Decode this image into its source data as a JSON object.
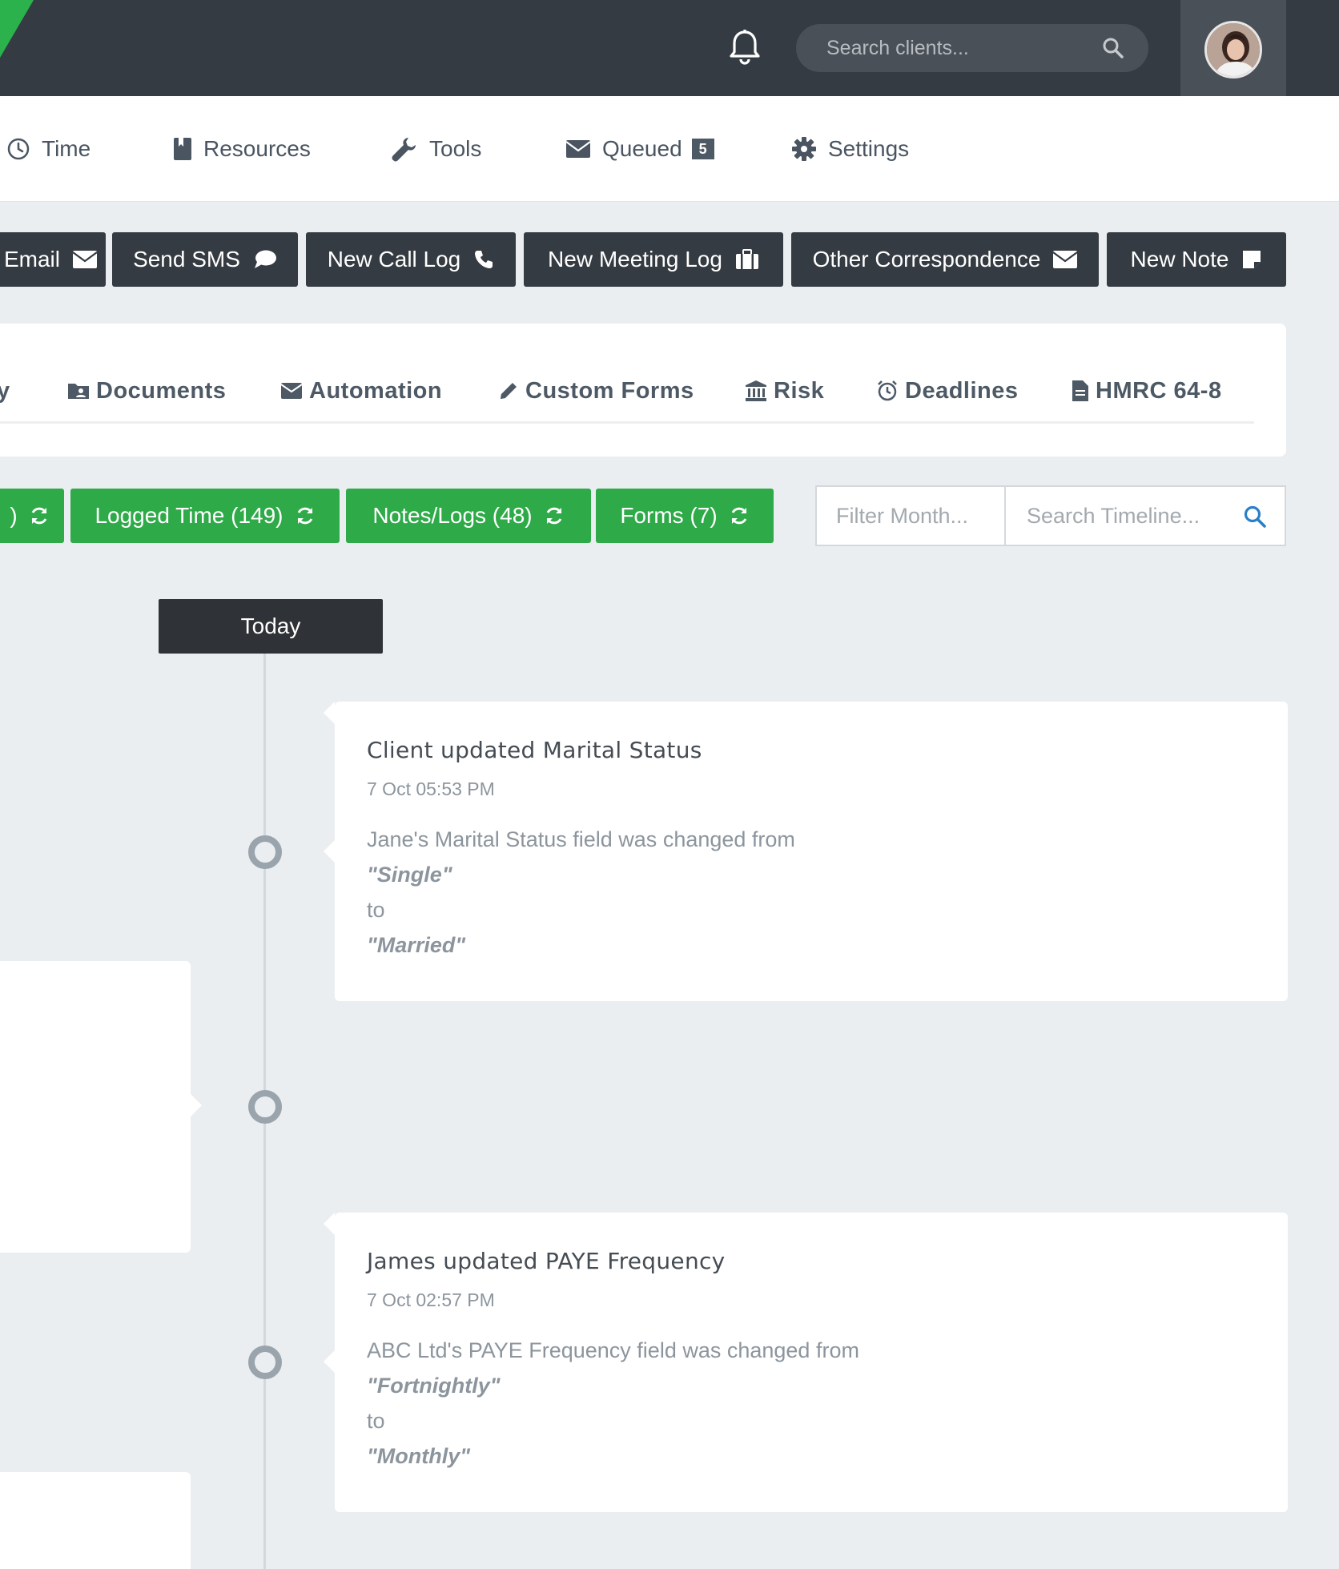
{
  "topbar": {
    "search_placeholder": "Search clients...",
    "notification_icon": "bell-icon",
    "avatar_alt": "user-avatar"
  },
  "nav": {
    "items": [
      {
        "label": "Time",
        "icon": "clock-icon"
      },
      {
        "label": "Resources",
        "icon": "book-icon"
      },
      {
        "label": "Tools",
        "icon": "wrench-icon"
      },
      {
        "label": "Queued",
        "icon": "envelope-icon",
        "badge": "5"
      },
      {
        "label": "Settings",
        "icon": "gear-icon"
      }
    ]
  },
  "actions": [
    {
      "label": "Email",
      "icon": "envelope-icon"
    },
    {
      "label": "Send SMS",
      "icon": "speech-bubble-icon"
    },
    {
      "label": "New Call Log",
      "icon": "phone-icon"
    },
    {
      "label": "New Meeting Log",
      "icon": "briefcase-icon"
    },
    {
      "label": "Other Correspondence",
      "icon": "envelope-icon"
    },
    {
      "label": "New Note",
      "icon": "note-icon"
    }
  ],
  "tabs": [
    {
      "label": "y",
      "icon": ""
    },
    {
      "label": "Documents",
      "icon": "folder-user-icon"
    },
    {
      "label": "Automation",
      "icon": "envelope-icon"
    },
    {
      "label": "Custom Forms",
      "icon": "pencil-icon"
    },
    {
      "label": "Risk",
      "icon": "bank-icon"
    },
    {
      "label": "Deadlines",
      "icon": "alarm-clock-icon"
    },
    {
      "label": "HMRC 64-8",
      "icon": "file-icon"
    }
  ],
  "filters": [
    {
      "label": ")"
    },
    {
      "label": "Logged Time (149)"
    },
    {
      "label": "Notes/Logs (48)"
    },
    {
      "label": "Forms (7)"
    }
  ],
  "timeline_search": {
    "month_placeholder": "Filter Month...",
    "search_placeholder": "Search Timeline..."
  },
  "timeline": {
    "today_label": "Today",
    "events": [
      {
        "title": "Client updated Marital Status",
        "time": "7 Oct 05:53 PM",
        "body_intro": "Jane's Marital Status field was changed from",
        "from": "\"Single\"",
        "to_label": "to",
        "to": "\"Married\""
      },
      {
        "title": "James updated PAYE Frequency",
        "time": "7 Oct 02:57 PM",
        "body_intro": "ABC Ltd's PAYE Frequency field was changed from",
        "from": "\"Fortnightly\"",
        "to_label": "to",
        "to": "\"Monthly\""
      }
    ]
  },
  "colors": {
    "topbar": "#353b42",
    "accent_green": "#2eaa48",
    "dark_button": "#353b42"
  }
}
